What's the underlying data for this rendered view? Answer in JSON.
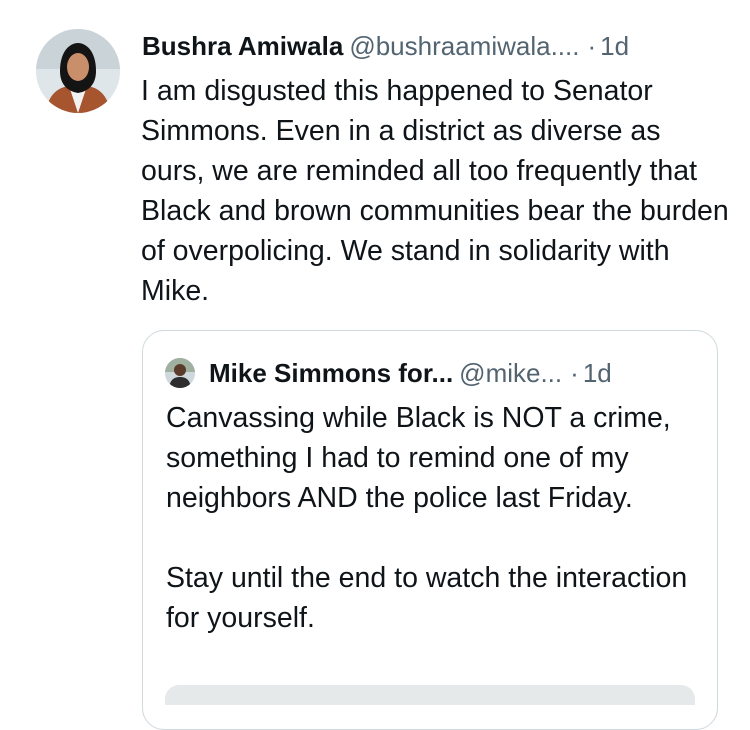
{
  "tweet": {
    "author_name": "Bushra Amiwala",
    "author_handle": "@bushraamiwala....",
    "separator": "·",
    "time": "1d",
    "text": "I am disgusted this happened to Senator Simmons. Even in a district as diverse as ours, we are reminded all too frequently that Black and brown communities bear the burden of overpolicing. We stand in solidarity with Mike."
  },
  "quoted_tweet": {
    "author_name": "Mike Simmons for...",
    "author_handle": "@mike...",
    "separator": "·",
    "time": "1d",
    "text": "Canvassing while Black is NOT a crime, something I had to remind one of my neighbors AND the police last Friday.\n\nStay until the end to watch the interaction for yourself."
  },
  "colors": {
    "text_primary": "#0f1419",
    "text_secondary": "#536471",
    "border": "#cfd9de",
    "background": "#ffffff"
  }
}
